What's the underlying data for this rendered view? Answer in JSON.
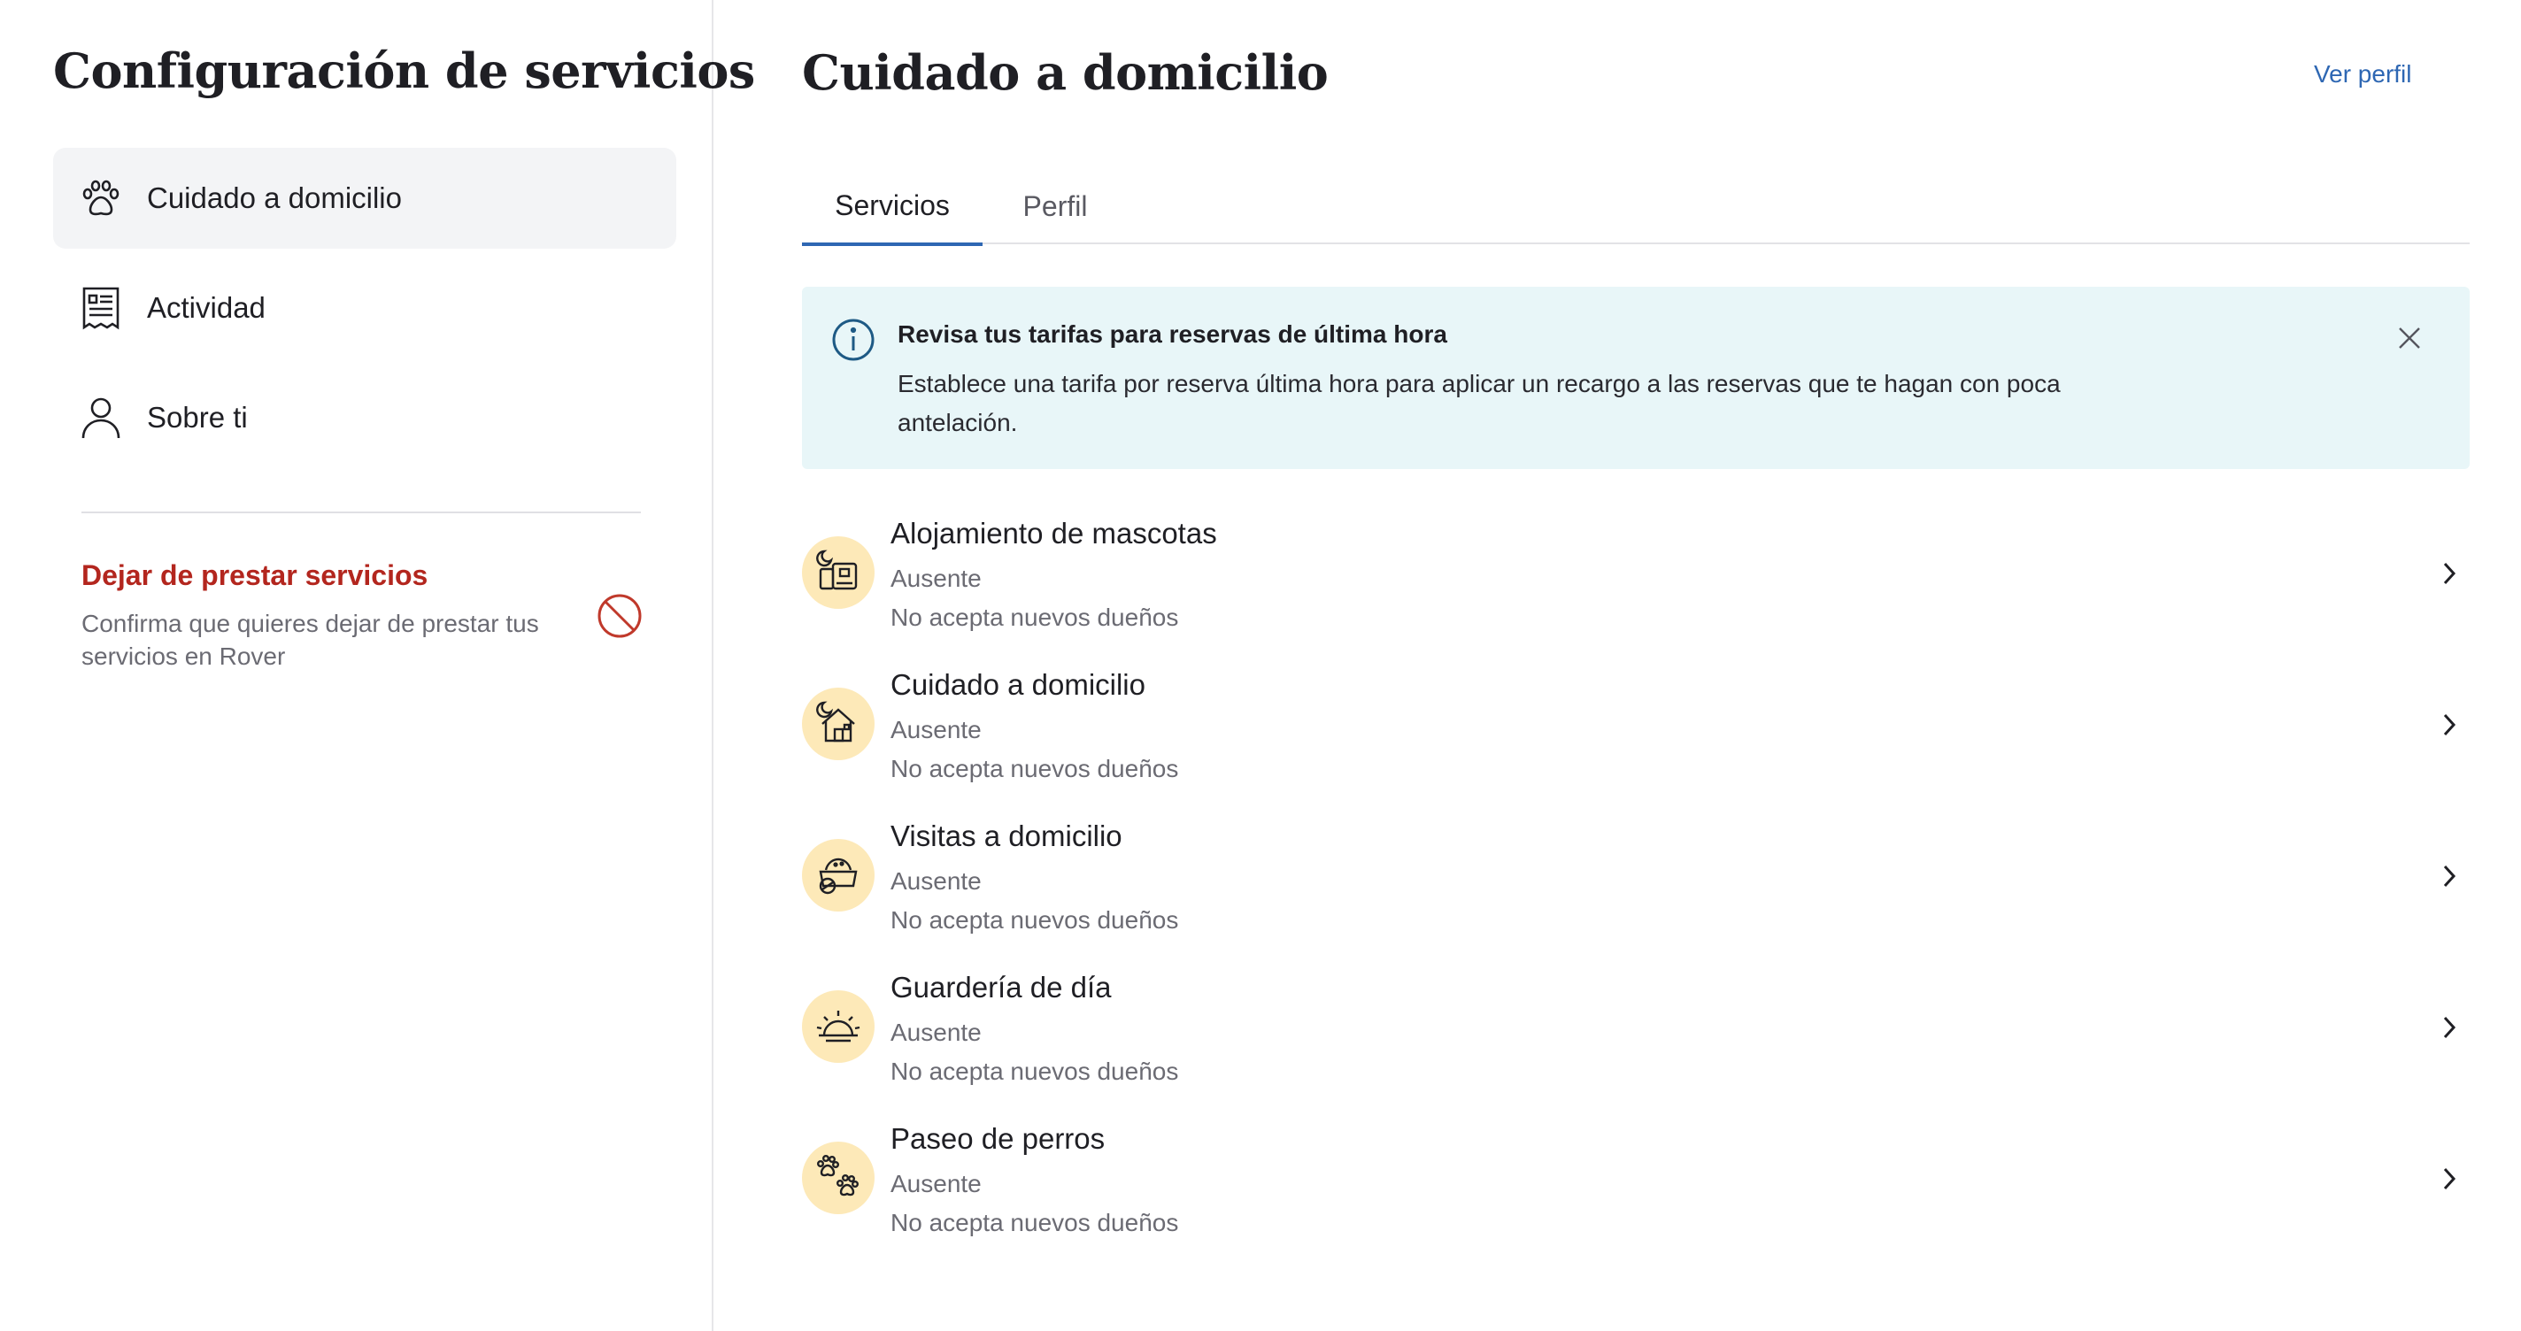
{
  "sidebar": {
    "title": "Configuración de servicios",
    "items": [
      {
        "label": "Cuidado a domicilio",
        "icon": "paw-icon",
        "active": true
      },
      {
        "label": "Actividad",
        "icon": "receipt-icon",
        "active": false
      },
      {
        "label": "Sobre ti",
        "icon": "user-icon",
        "active": false
      }
    ],
    "stop": {
      "title": "Dejar de prestar servicios",
      "description": "Confirma que quieres dejar de prestar tus servicios en Rover",
      "icon": "prohibited-icon"
    }
  },
  "main": {
    "title": "Cuidado a domicilio",
    "view_profile": "Ver perfil",
    "tabs": [
      {
        "label": "Servicios",
        "active": true
      },
      {
        "label": "Perfil",
        "active": false
      }
    ],
    "banner": {
      "title": "Revisa tus tarifas para reservas de última hora",
      "text": "Establece una tarifa por reserva última hora para aplicar un recargo a las reservas que te hagan con poca antelación.",
      "icon": "info-icon"
    },
    "services": [
      {
        "name": "Alojamiento de mascotas",
        "status": "Ausente",
        "owners": "No acepta nuevos dueños",
        "icon": "boarding-icon"
      },
      {
        "name": "Cuidado a domicilio",
        "status": "Ausente",
        "owners": "No acepta nuevos dueños",
        "icon": "house-sitting-icon"
      },
      {
        "name": "Visitas a domicilio",
        "status": "Ausente",
        "owners": "No acepta nuevos dueños",
        "icon": "food-bowl-icon"
      },
      {
        "name": "Guardería de día",
        "status": "Ausente",
        "owners": "No acepta nuevos dueños",
        "icon": "sun-icon"
      },
      {
        "name": "Paseo de perros",
        "status": "Ausente",
        "owners": "No acepta nuevos dueños",
        "icon": "paws-icon"
      }
    ]
  },
  "colors": {
    "accent": "#2e67b3",
    "danger": "#b3261e",
    "banner_bg": "#e8f6f8",
    "service_icon_bg": "#fde9b8",
    "active_nav_bg": "#f3f4f6"
  }
}
